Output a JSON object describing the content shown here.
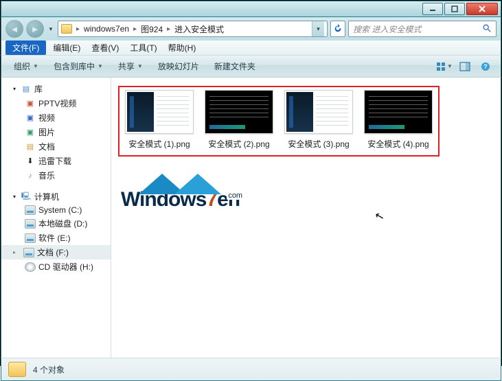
{
  "path": {
    "seg1": "windows7en",
    "seg2": "图924",
    "seg3": "进入安全模式"
  },
  "search": {
    "placeholder": "搜索 进入安全模式"
  },
  "menu": {
    "file": "文件(F)",
    "edit": "编辑(E)",
    "view": "查看(V)",
    "tools": "工具(T)",
    "help": "帮助(H)"
  },
  "cmd": {
    "organize": "组织",
    "include": "包含到库中",
    "share": "共享",
    "slideshow": "放映幻灯片",
    "newfolder": "新建文件夹"
  },
  "nav": {
    "libraries": "库",
    "pptv": "PPTV视频",
    "videos": "视频",
    "pictures": "图片",
    "documents": "文档",
    "dl_broken": "迅雷下载",
    "music": "音乐",
    "computer": "计算机",
    "driveC": "System (C:)",
    "driveD": "本地磁盘 (D:)",
    "driveE": "软件 (E:)",
    "driveF": "文档 (F:)",
    "driveCD": "CD 驱动器 (H:)"
  },
  "files": [
    {
      "name": "安全模式 (1).png",
      "style": "A"
    },
    {
      "name": "安全模式 (2).png",
      "style": "B"
    },
    {
      "name": "安全模式 (3).png",
      "style": "A"
    },
    {
      "name": "安全模式 (4).png",
      "style": "B"
    }
  ],
  "status": {
    "count": "4 个对象"
  },
  "watermark": {
    "brand_a": "Windows",
    "brand_b": "7",
    "brand_c": "en",
    "com": "com"
  }
}
